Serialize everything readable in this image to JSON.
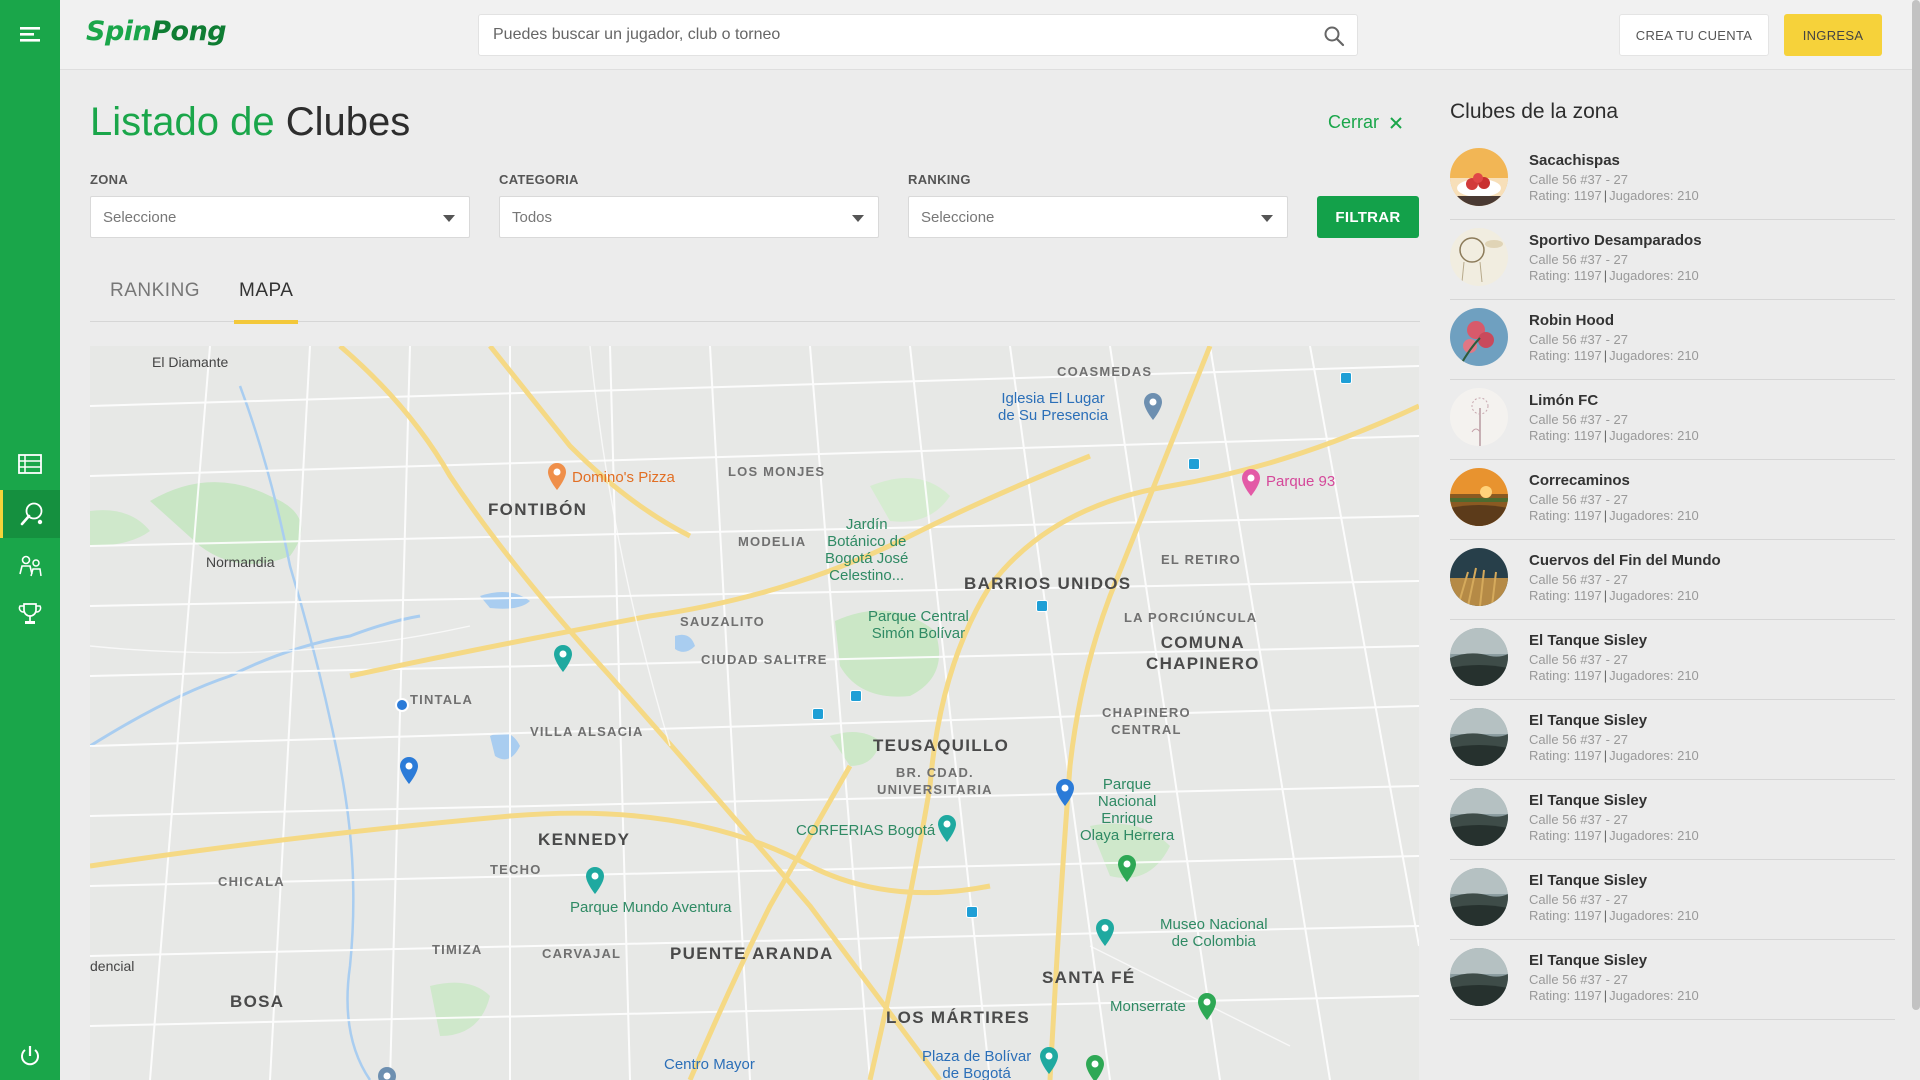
{
  "header": {
    "logo_part1": "Spin",
    "logo_part2": "Pong",
    "search_placeholder": "Puedes buscar un jugador, club o torneo",
    "create_account": "CREA TU CUENTA",
    "login": "INGRESA"
  },
  "sidebar": {
    "icons": [
      "menu-icon",
      "list-icon",
      "ping-pong-paddle-icon",
      "players-icon",
      "trophy-icon",
      "power-icon"
    ],
    "active": "ping-pong-paddle-icon"
  },
  "page": {
    "title_part1": "Listado de",
    "title_part2": "Clubes",
    "close_label": "Cerrar"
  },
  "filters": {
    "zona": {
      "label": "ZONA",
      "value": "Seleccione"
    },
    "categoria": {
      "label": "CATEGORIA",
      "value": "Todos"
    },
    "ranking": {
      "label": "RANKING",
      "value": "Seleccione"
    },
    "button": "FILTRAR"
  },
  "tabs": [
    {
      "label": "RANKING",
      "active": false
    },
    {
      "label": "MAPA",
      "active": true
    }
  ],
  "map": {
    "labels": {
      "el_diamante": "El Diamante",
      "coasmedas": "COASMEDAS",
      "iglesia": "Iglesia El Lugar\nde Su Presencia",
      "dominos": "Domino's Pizza",
      "los_monjes": "LOS MONJES",
      "parque93": "Parque 93",
      "fontibon": "FONTIBÓN",
      "normandia": "Normandia",
      "modelia": "MODELIA",
      "jardin": "Jardín\nBotánico de\nBogotá José\nCelestino...",
      "el_retiro": "EL RETIRO",
      "barrios_unidos": "BARRIOS UNIDOS",
      "la_porciuncula": "LA PORCIÚNCULA",
      "parque_central": "Parque Central\nSimón Bolívar",
      "sauzalito": "SAUZALITO",
      "comuna_chapinero": "COMUNA\nCHAPINERO",
      "ciudad_salitre": "CIUDAD SALITRE",
      "tintala": "TINTALA",
      "chapinero_central": "CHAPINERO\nCENTRAL",
      "villa_alsacia": "VILLA ALSACIA",
      "teusaquillo": "TEUSAQUILLO",
      "br_cdad": "BR. CDAD.\nUNIVERSITARIA",
      "parque_nacional": "Parque\nNacional\nEnrique\nOlaya Herrera",
      "kennedy": "KENNEDY",
      "corferias": "CORFERIAS Bogotá",
      "techo": "TECHO",
      "parque_mundo": "Parque Mundo Aventura",
      "chicala": "CHICALA",
      "timiza": "TIMIZA",
      "carvajal": "CARVAJAL",
      "puente_aranda": "PUENTE ARANDA",
      "museo": "Museo Nacional\nde Colombia",
      "santa_fe": "SANTA FÉ",
      "bosa": "BOSA",
      "los_martires": "LOS MÁRTIRES",
      "monserrate": "Monserrate",
      "plaza_bolivar": "Plaza de Bolívar\nde Bogotá",
      "centro_mayor": "Centro Mayor",
      "dencial": "dencial"
    }
  },
  "zone_panel": {
    "title": "Clubes de la zona",
    "clubs": [
      {
        "name": "Sacachispas",
        "address": "Calle 56 #37 - 27",
        "rating": "Rating: 1197",
        "players": "Jugadores: 210",
        "avatar": "strawberries"
      },
      {
        "name": "Sportivo Desamparados",
        "address": "Calle 56 #37 - 27",
        "rating": "Rating: 1197",
        "players": "Jugadores: 210",
        "avatar": "dreamcatcher"
      },
      {
        "name": "Robin Hood",
        "address": "Calle 56 #37 - 27",
        "rating": "Rating: 1197",
        "players": "Jugadores: 210",
        "avatar": "flowers"
      },
      {
        "name": "Limón FC",
        "address": "Calle 56 #37 - 27",
        "rating": "Rating: 1197",
        "players": "Jugadores: 210",
        "avatar": "dandelion"
      },
      {
        "name": "Correcaminos",
        "address": "Calle 56 #37 - 27",
        "rating": "Rating: 1197",
        "players": "Jugadores: 210",
        "avatar": "sunset"
      },
      {
        "name": "Cuervos del Fin del Mundo",
        "address": "Calle 56 #37 - 27",
        "rating": "Rating: 1197",
        "players": "Jugadores: 210",
        "avatar": "wheat"
      },
      {
        "name": "El Tanque Sisley",
        "address": "Calle 56 #37 - 27",
        "rating": "Rating: 1197",
        "players": "Jugadores: 210",
        "avatar": "foggy"
      },
      {
        "name": "El Tanque Sisley",
        "address": "Calle 56 #37 - 27",
        "rating": "Rating: 1197",
        "players": "Jugadores: 210",
        "avatar": "foggy"
      },
      {
        "name": "El Tanque Sisley",
        "address": "Calle 56 #37 - 27",
        "rating": "Rating: 1197",
        "players": "Jugadores: 210",
        "avatar": "foggy"
      },
      {
        "name": "El Tanque Sisley",
        "address": "Calle 56 #37 - 27",
        "rating": "Rating: 1197",
        "players": "Jugadores: 210",
        "avatar": "foggy"
      },
      {
        "name": "El Tanque Sisley",
        "address": "Calle 56 #37 - 27",
        "rating": "Rating: 1197",
        "players": "Jugadores: 210",
        "avatar": "foggy"
      }
    ]
  },
  "colors": {
    "brand_green": "#1aa64a",
    "accent_yellow": "#f6d23a",
    "background": "#ececec"
  }
}
